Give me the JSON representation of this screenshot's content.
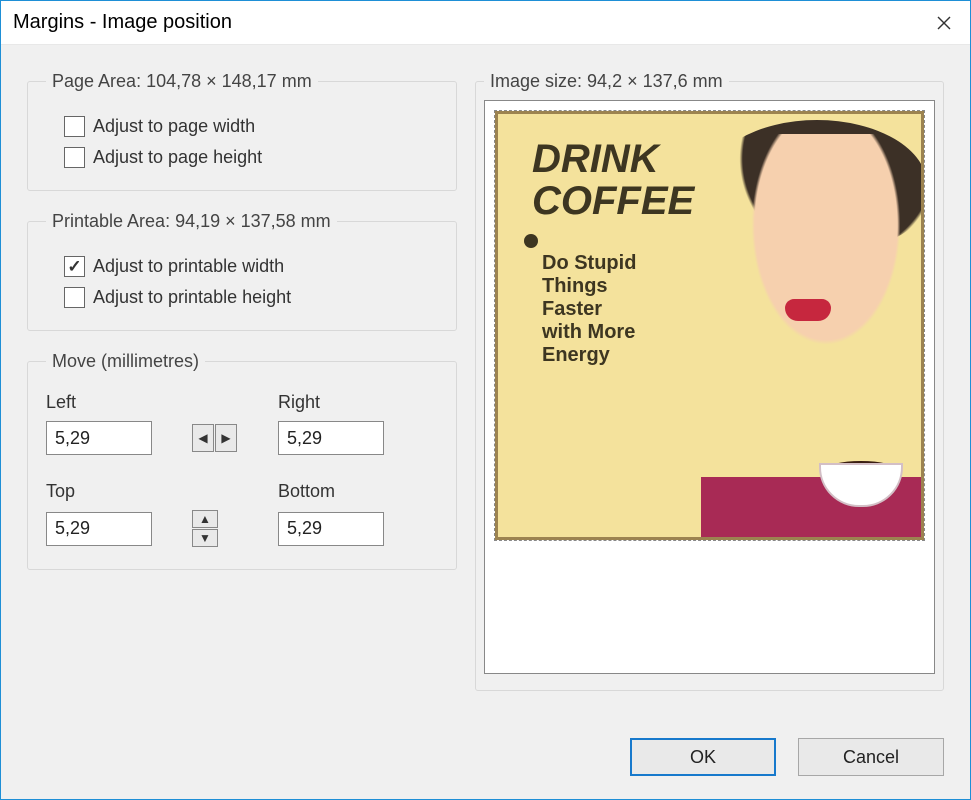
{
  "window": {
    "title": "Margins - Image position"
  },
  "pageArea": {
    "legend": "Page Area: 104,78 × 148,17 mm",
    "adjustWidthLabel": "Adjust to page width",
    "adjustHeightLabel": "Adjust to page height",
    "adjustWidthChecked": false,
    "adjustHeightChecked": false
  },
  "printableArea": {
    "legend": "Printable Area: 94,19 × 137,58 mm",
    "adjustWidthLabel": "Adjust to printable width",
    "adjustHeightLabel": "Adjust to printable height",
    "adjustWidthChecked": true,
    "adjustHeightChecked": false
  },
  "move": {
    "legend": "Move (millimetres)",
    "leftLabel": "Left",
    "rightLabel": "Right",
    "topLabel": "Top",
    "bottomLabel": "Bottom",
    "left": "5,29",
    "right": "5,29",
    "top": "5,29",
    "bottom": "5,29"
  },
  "preview": {
    "legend": "Image size: 94,2 × 137,6 mm",
    "posterTitle": "DRINK\nCOFFEE",
    "posterSub": "Do Stupid\nThings\nFaster\nwith More\nEnergy"
  },
  "buttons": {
    "ok": "OK",
    "cancel": "Cancel"
  }
}
